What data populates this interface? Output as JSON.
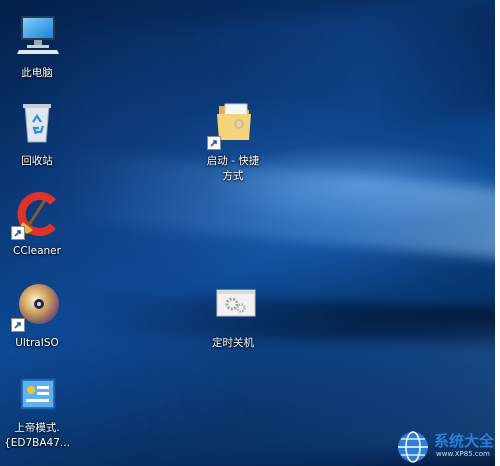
{
  "desktop": {
    "icons": [
      {
        "label": "此电脑",
        "icon": "computer-icon"
      },
      {
        "label": "回收站",
        "icon": "recycle-bin-icon"
      },
      {
        "label": "CCleaner",
        "icon": "ccleaner-icon"
      },
      {
        "label": "UltraISO",
        "icon": "ultraiso-icon"
      },
      {
        "label": "上帝模式.\n{ED7BA47...",
        "icon": "god-mode-icon"
      },
      {
        "label": "启动 - 快捷\n方式",
        "icon": "folder-icon"
      },
      {
        "label": "定时关机",
        "icon": "gears-window-icon"
      }
    ]
  },
  "watermark": {
    "text": "系统大全",
    "sub": "www.XP85.com",
    "icon": "globe-logo-icon"
  },
  "colors": {
    "accent": "#2a7fd6",
    "desktop_dark": "#021a3e",
    "desktop_mid": "#0c4a94"
  }
}
